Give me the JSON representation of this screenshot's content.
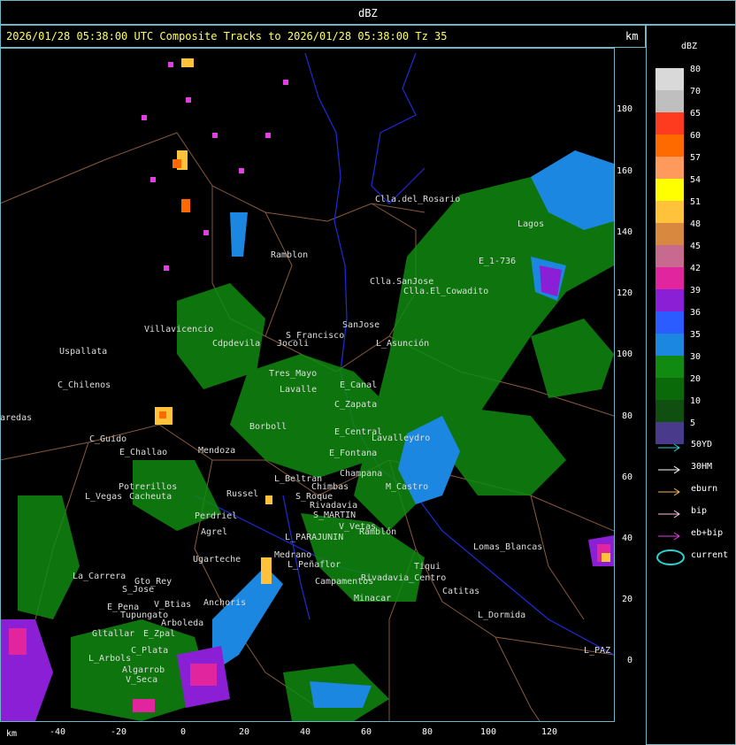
{
  "title": "dBZ",
  "header": {
    "text": "2026/01/28 05:38:00 UTC Composite Tracks to 2026/01/28 05:38:00 Tz 35",
    "unit": "km"
  },
  "axes": {
    "x_label": "km",
    "x_ticks": [
      "-40",
      "-20",
      "0",
      "20",
      "40",
      "60",
      "80",
      "100",
      "120"
    ],
    "y_ticks": [
      "180",
      "160",
      "140",
      "120",
      "100",
      "80",
      "60",
      "40",
      "20",
      "0"
    ]
  },
  "legend": {
    "title": "dBZ",
    "levels": [
      {
        "label": "80",
        "color": "#d9d9d9"
      },
      {
        "label": "70",
        "color": "#bfbfbf"
      },
      {
        "label": "65",
        "color": "#ff3b1f"
      },
      {
        "label": "60",
        "color": "#ff6a00"
      },
      {
        "label": "57",
        "color": "#ff9a5c"
      },
      {
        "label": "54",
        "color": "#ffff00"
      },
      {
        "label": "51",
        "color": "#ffc23a"
      },
      {
        "label": "48",
        "color": "#d8883f"
      },
      {
        "label": "45",
        "color": "#c86a8f"
      },
      {
        "label": "42",
        "color": "#e0259f"
      },
      {
        "label": "39",
        "color": "#8a1fd6"
      },
      {
        "label": "36",
        "color": "#2a5cff"
      },
      {
        "label": "35",
        "color": "#1b87e0"
      },
      {
        "label": "30",
        "color": "#118a11"
      },
      {
        "label": "20",
        "color": "#0a6a0a"
      },
      {
        "label": "10",
        "color": "#0f4f0f"
      },
      {
        "label": "5",
        "color": "#4a3a8c"
      }
    ],
    "tracks": [
      {
        "label": "50YD",
        "color": "#29d3d3"
      },
      {
        "label": "30HM",
        "color": "#ffffff"
      },
      {
        "label": "eburn",
        "color": "#f5b25c"
      },
      {
        "label": "bip",
        "color": "#ffc0e0"
      },
      {
        "label": "eb+bip",
        "color": "#e040e0"
      },
      {
        "label": "current",
        "color": "#29d3d3"
      }
    ]
  },
  "places": [
    "Clla.del_Rosario",
    "Ramblon",
    "Clla.SanJose",
    "Clla.El_Cowadito",
    "E_1-736",
    "Lagos",
    "Villavicencio",
    "Uspallata",
    "Cdpdevila",
    "S_Francisco",
    "Jocoli",
    "SanJose",
    "L_Asunción",
    "C_Chilenos",
    "Tres_Mayo",
    "Lavalle",
    "E_Canal",
    "C_Zapata",
    "Borboll",
    "E_Central",
    "Lavalleydro",
    "C_Guido",
    "E_Challao",
    "Mendoza",
    "E_Fontana",
    "L_Beltran",
    "Chimbas",
    "Champana",
    "M_Castro",
    "Potrerillos",
    "L_Vegas",
    "Cacheuta",
    "Russel",
    "S_Roque",
    "Rivadavia",
    "S_MARTIN",
    "Perdriel",
    "Agrel",
    "L_PARAJUNIN",
    "V_Vetas",
    "Ramblón",
    "Ugarteche",
    "Tiqui",
    "Lomas_Blancas",
    "Medrano",
    "L_Peñaflor",
    "Rivadavia_Centro",
    "Catitas",
    "La_Carrera",
    "Gto_Rey",
    "S_Jose",
    "E_Pena",
    "V_Btias",
    "Anchoris",
    "Tupungato",
    "Arboleda",
    "Gltallar",
    "E_Zpal",
    "C_Plata",
    "L_Arbols",
    "Algarrob",
    "V_Seca",
    "Campamentos",
    "Minacar",
    "L_Dormida",
    "L_PAZ",
    "aredas"
  ]
}
